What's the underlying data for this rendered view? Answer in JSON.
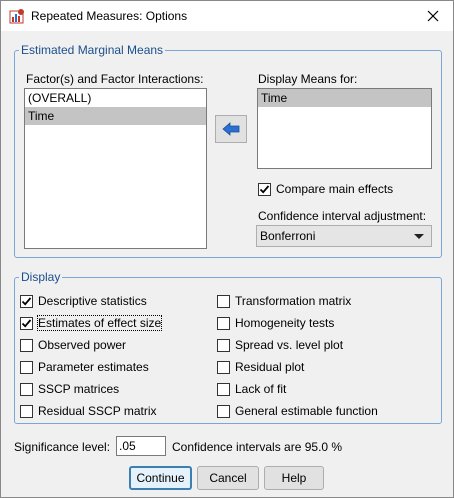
{
  "window": {
    "title": "Repeated Measures: Options"
  },
  "emm": {
    "group_label": "Estimated Marginal Means",
    "factors_label": "Factor(s) and Factor Interactions:",
    "factors": [
      "(OVERALL)",
      "Time"
    ],
    "display_label": "Display Means for:",
    "display_items": [
      "Time"
    ],
    "compare_main_effects_label": "Compare main effects",
    "compare_main_effects_checked": true,
    "ci_adjustment_label": "Confidence interval adjustment:",
    "ci_adjustment_value": "Bonferroni"
  },
  "display": {
    "group_label": "Display",
    "left_options": [
      {
        "label": "Descriptive statistics",
        "checked": true
      },
      {
        "label": "Estimates of effect size",
        "checked": true
      },
      {
        "label": "Observed power",
        "checked": false
      },
      {
        "label": "Parameter estimates",
        "checked": false
      },
      {
        "label": "SSCP matrices",
        "checked": false
      },
      {
        "label": "Residual SSCP matrix",
        "checked": false
      }
    ],
    "right_options": [
      {
        "label": "Transformation matrix",
        "checked": false
      },
      {
        "label": "Homogeneity tests",
        "checked": false
      },
      {
        "label": "Spread vs. level plot",
        "checked": false
      },
      {
        "label": "Residual plot",
        "checked": false
      },
      {
        "label": "Lack of fit",
        "checked": false
      },
      {
        "label": "General estimable function",
        "checked": false
      }
    ]
  },
  "significance": {
    "label": "Significance level:",
    "value": ".05",
    "ci_text": "Confidence intervals are 95.0 %"
  },
  "buttons": {
    "continue": "Continue",
    "cancel": "Cancel",
    "help": "Help"
  },
  "colors": {
    "group_border": "#7ba7d7",
    "group_label": "#1a4f8c",
    "selection": "#c4c4c4",
    "arrow_blue": "#2c6fd0"
  }
}
